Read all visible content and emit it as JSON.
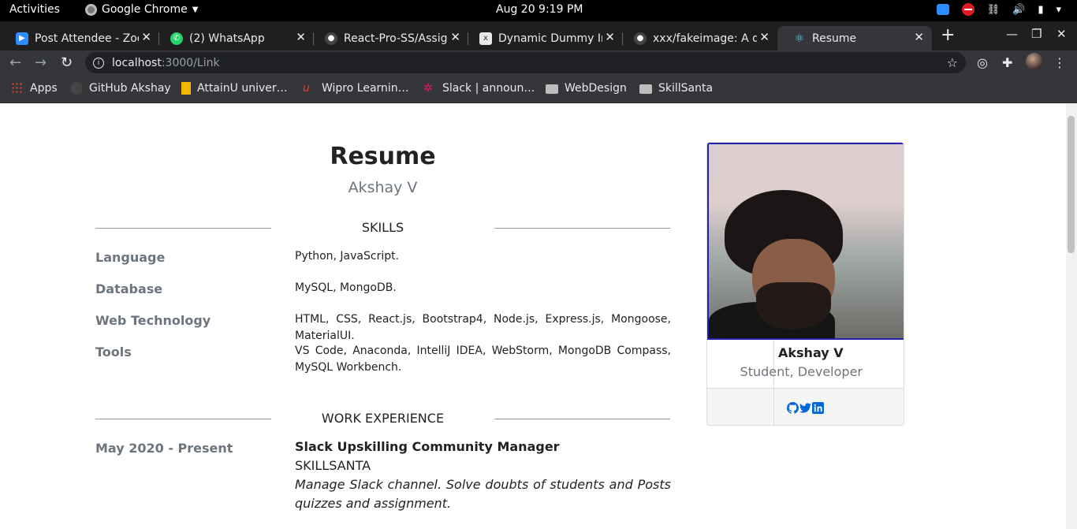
{
  "topbar": {
    "activities": "Activities",
    "app_name": "Google Chrome",
    "clock": "Aug 20   9:19 PM"
  },
  "tabs": [
    {
      "title": "Post Attendee - Zoom",
      "icon": "zoom-icon",
      "color": "#2d8cff"
    },
    {
      "title": "(2) WhatsApp",
      "icon": "whatsapp-icon",
      "color": "#25d366"
    },
    {
      "title": "React-Pro-SS/Assignment",
      "icon": "github-icon",
      "color": "#ffffff"
    },
    {
      "title": "Dynamic Dummy Image",
      "icon": "x-favicon-icon",
      "color": "#d0d0d0"
    },
    {
      "title": "xxx/fakeimage: A dynamic",
      "icon": "github-icon",
      "color": "#ffffff"
    },
    {
      "title": "Resume",
      "icon": "react-icon",
      "color": "#61dafb"
    }
  ],
  "toolbar": {
    "url_host": "localhost",
    "url_path": ":3000/Link"
  },
  "bookmarks": [
    {
      "label": "Apps",
      "icon": "apps-grid-icon"
    },
    {
      "label": "GitHub Akshay",
      "icon": "github-icon"
    },
    {
      "label": "AttainU univer…",
      "icon": "attainu-icon"
    },
    {
      "label": "Wipro Learnin…",
      "icon": "wipro-icon"
    },
    {
      "label": "Slack | announ…",
      "icon": "slack-icon"
    },
    {
      "label": "WebDesign",
      "icon": "folder-icon"
    },
    {
      "label": "SkillSanta",
      "icon": "folder-icon"
    }
  ],
  "resume": {
    "title": "Resume",
    "name": "Akshay V",
    "skills_heading": "SKILLS",
    "skills": [
      {
        "key": "Language",
        "value": "Python, JavaScript."
      },
      {
        "key": "Database",
        "value": "MySQL, MongoDB."
      },
      {
        "key": "Web Technology",
        "value": "HTML, CSS, React.js, Bootstrap4, Node.js, Express.js, Mongoose, MaterialUI."
      },
      {
        "key": "Tools",
        "value": "VS Code, Anaconda, IntelliJ IDEA, WebStorm, MongoDB Compass, MySQL Workbench."
      }
    ],
    "work_heading": "WORK EXPERIENCE",
    "jobs": [
      {
        "period": "May 2020 - Present",
        "title": "Slack Upskilling Community Manager",
        "company": "SKILLSANTA",
        "description": "Manage Slack channel. Solve doubts of students and Posts quizzes and assignment."
      }
    ]
  },
  "profile": {
    "name": "Akshay V",
    "role": "Student, Developer",
    "social": [
      "github-icon",
      "twitter-icon",
      "linkedin-icon"
    ],
    "link_color": "#0366d6"
  }
}
